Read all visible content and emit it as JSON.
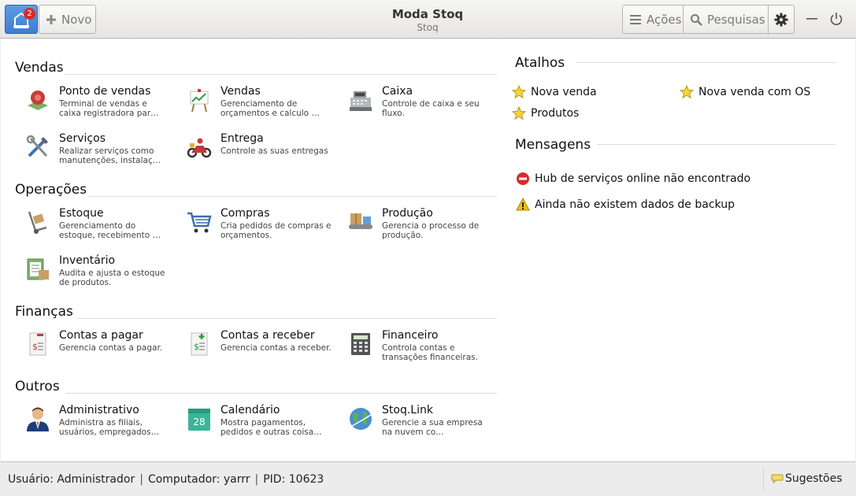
{
  "header": {
    "title": "Moda Stoq",
    "subtitle": "Stoq",
    "badge_count": "2",
    "new_label": "Novo",
    "actions_label": "Ações",
    "search_label": "Pesquisas"
  },
  "sections": {
    "vendas": {
      "title": "Vendas",
      "apps": [
        {
          "name": "Ponto de vendas",
          "desc": "Terminal de vendas e caixa registradora par…",
          "icon": "pos-icon"
        },
        {
          "name": "Vendas",
          "desc": "Gerenciamento de orçamentos e calculo …",
          "icon": "sales-chart-icon"
        },
        {
          "name": "Caixa",
          "desc": "Controle de caixa e seu fluxo.",
          "icon": "cash-register-icon"
        },
        {
          "name": "Serviços",
          "desc": "Realizar serviços como manutenções, instalaç…",
          "icon": "tools-icon"
        },
        {
          "name": "Entrega",
          "desc": "Controle as suas entregas",
          "icon": "motorcycle-icon"
        }
      ]
    },
    "operacoes": {
      "title": "Operações",
      "apps": [
        {
          "name": "Estoque",
          "desc": "Gerenciamento do estoque, recebimento …",
          "icon": "hand-truck-icon"
        },
        {
          "name": "Compras",
          "desc": "Cria pedidos de compras e orçamentos.",
          "icon": "shopping-cart-icon"
        },
        {
          "name": "Produção",
          "desc": "Gerencia o processo de produção.",
          "icon": "conveyor-icon"
        },
        {
          "name": "Inventário",
          "desc": "Audita e ajusta o estoque de produtos.",
          "icon": "clipboard-boxes-icon"
        }
      ]
    },
    "financas": {
      "title": "Finanças",
      "apps": [
        {
          "name": "Contas a pagar",
          "desc": "Gerencia contas a pagar.",
          "icon": "bill-pay-icon"
        },
        {
          "name": "Contas a receber",
          "desc": "Gerencia contas a receber.",
          "icon": "bill-receive-icon"
        },
        {
          "name": "Financeiro",
          "desc": "Controla contas e transações financeiras.",
          "icon": "calculator-icon"
        }
      ]
    },
    "outros": {
      "title": "Outros",
      "apps": [
        {
          "name": "Administrativo",
          "desc": "Administra as filiais, usuários, empregados…",
          "icon": "admin-user-icon"
        },
        {
          "name": "Calendário",
          "desc": "Mostra pagamentos, pedidos e outras coisa…",
          "icon": "calendar-icon",
          "calendar_day": "28"
        },
        {
          "name": "Stoq.Link",
          "desc": "Gerencie a sua empresa na nuvem co…",
          "icon": "globe-icon"
        }
      ]
    }
  },
  "shortcuts": {
    "title": "Atalhos",
    "items": [
      "Nova venda",
      "Nova venda com OS",
      "Produtos"
    ]
  },
  "messages": {
    "title": "Mensagens",
    "items": [
      {
        "text": "Hub de serviços online não encontrado",
        "kind": "error"
      },
      {
        "text": "Ainda não existem dados de backup",
        "kind": "warning"
      }
    ]
  },
  "statusbar": {
    "user": "Usuário: Administrador",
    "computer": "Computador: yarrr",
    "pid": "PID: 10623",
    "separator": "|",
    "suggestions_label": "Sugestões"
  },
  "colors": {
    "accent": "#3d7ed1",
    "badge": "#d62b2b",
    "error": "#d62b2b",
    "warning": "#f2c200"
  }
}
